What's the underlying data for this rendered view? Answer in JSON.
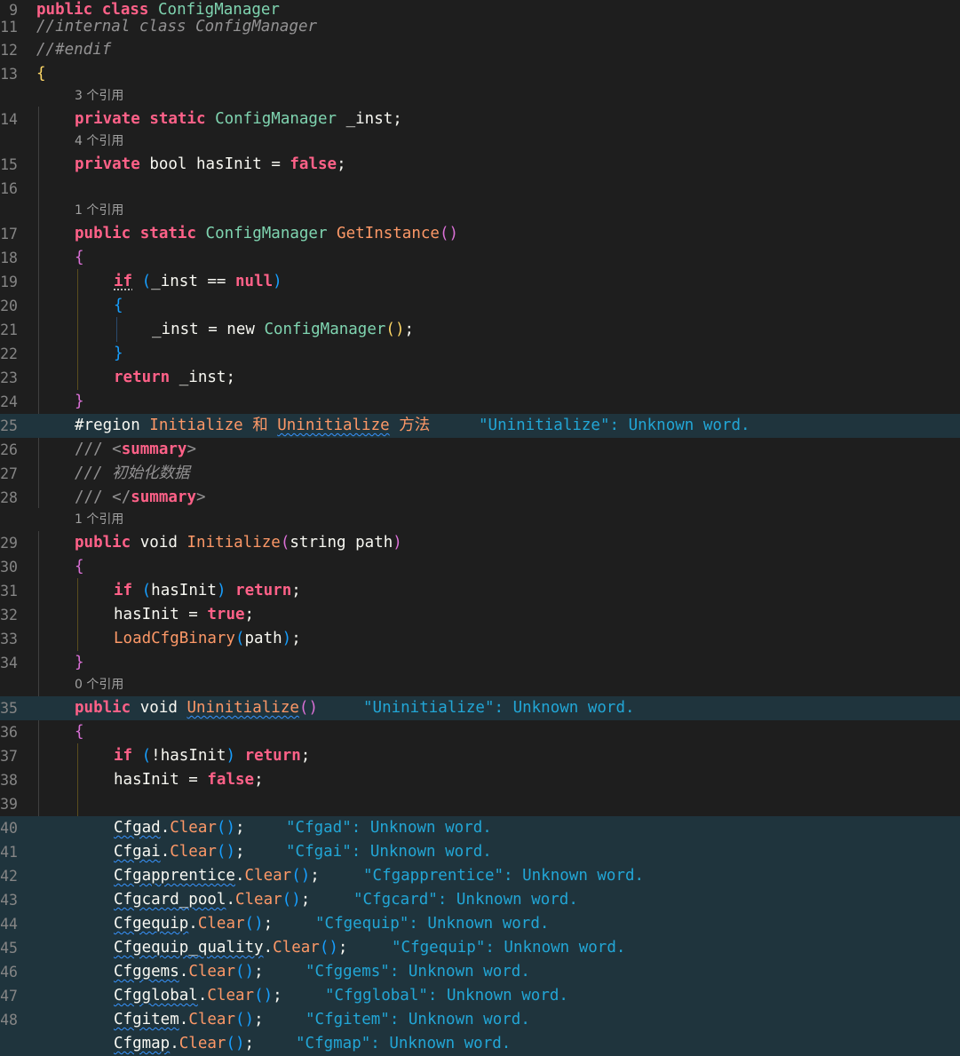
{
  "lens": {
    "r3": "3 个引用",
    "r4": "4 个引用",
    "r1a": "1 个引用",
    "r1b": "1 个引用",
    "r0": "0 个引用"
  },
  "lines": {
    "l9": "9",
    "l11": "11",
    "l12": "12",
    "l13": "13",
    "l14": "14",
    "l15": "15",
    "l16": "16",
    "l17": "17",
    "l18": "18",
    "l19": "19",
    "l20": "20",
    "l21": "21",
    "l22": "22",
    "l23": "23",
    "l24": "24",
    "l25": "25",
    "l26": "26",
    "l27": "27",
    "l28": "28",
    "l29": "29",
    "l30": "30",
    "l31": "31",
    "l32": "32",
    "l33": "33",
    "l34": "34",
    "l35": "35",
    "l36": "36",
    "l37": "37",
    "l38": "38",
    "l39": "39",
    "l40": "40",
    "l41": "41",
    "l42": "42",
    "l43": "43",
    "l44": "44",
    "l45": "45",
    "l46": "46",
    "l47": "47",
    "l48": "48"
  },
  "tok": {
    "public": "public",
    "class": "class",
    "private": "private",
    "static": "static",
    "bool": "bool",
    "void": "void",
    "string": "string",
    "if": "if",
    "return": "return",
    "new": "new",
    "null": "null",
    "false": "false",
    "true": "true",
    "ConfigManager": "ConfigManager",
    "_inst": "_inst",
    "hasInit": "hasInit",
    "GetInstance": "GetInstance",
    "Initialize": "Initialize",
    "Uninitialize": "Uninitialize",
    "LoadCfgBinary": "LoadCfgBinary",
    "path": "path",
    "Clear": "Clear",
    "eq": " = ",
    "eqeq": " == ",
    "semi": ";",
    "lp": "(",
    "rp": ")",
    "lb": "{",
    "rb": "}",
    "sp": " ",
    "dot": ".",
    "notop": "!"
  },
  "comments": {
    "c11": "//internal class ConfigManager",
    "c12": "//#endif",
    "c26a": "/// ",
    "c26b": "<",
    "c26c": "summary",
    "c26d": ">",
    "c27": "/// 初始化数据",
    "c28a": "/// ",
    "c28b": "</",
    "c28c": "summary",
    "c28d": ">"
  },
  "region": {
    "kw": "#region",
    "t1": " Initialize 和 ",
    "t2": "Uninitialize",
    "t3": " 方法"
  },
  "diagnostics": {
    "d25": "\"Uninitialize\": Unknown word.",
    "d35": "\"Uninitialize\": Unknown word.",
    "d40": "\"Cfgad\": Unknown word.",
    "d41": "\"Cfgai\": Unknown word.",
    "d42": "\"Cfgapprentice\": Unknown word.",
    "d43": "\"Cfgcard\": Unknown word.",
    "d44": "\"Cfgequip\": Unknown word.",
    "d45": "\"Cfgequip\": Unknown word.",
    "d46": "\"Cfggems\": Unknown word.",
    "d47": "\"Cfgglobal\": Unknown word.",
    "d48": "\"Cfgitem\": Unknown word.",
    "d49": "\"Cfgmap\": Unknown word."
  },
  "cfg": {
    "a": "Cfgad",
    "b": "Cfgai",
    "c": "Cfgapprentice",
    "d": "Cfgcard_pool",
    "e": "Cfgequip",
    "f": "Cfgequip_quality",
    "g": "Cfggems",
    "h": "Cfgglobal",
    "i": "Cfgitem",
    "j": "Cfgmap"
  }
}
